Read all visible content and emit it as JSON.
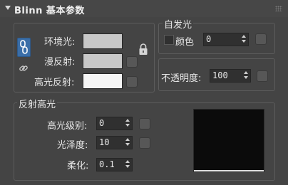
{
  "rollout": {
    "title": "Blinn 基本参数"
  },
  "ambient_group": {
    "ambient_label": "环境光:",
    "diffuse_label": "漫反射:",
    "specular_label": "高光反射:",
    "ambient_color": "#c8c8c8",
    "diffuse_color": "#c8c8c8",
    "specular_color": "#f5f5f5"
  },
  "self_illumination": {
    "title": "自发光",
    "color_label": "颜色",
    "value": "0"
  },
  "opacity": {
    "label": "不透明度:",
    "value": "100"
  },
  "specular_highlights": {
    "title": "反射高光",
    "level_label": "高光级别:",
    "level_value": "0",
    "gloss_label": "光泽度:",
    "gloss_value": "10",
    "soften_label": "柔化:",
    "soften_value": "0.1"
  },
  "icons": {
    "rollout_toggle": "triangle-down-icon",
    "lock": "padlock-icon",
    "link_ambient": "chain-link-icon",
    "link_small": "chain-icon",
    "grip": "grip-dots-icon"
  },
  "colors": {
    "panel_bg": "#444444",
    "accent_blue": "#3a6ea8",
    "curve_bg": "#0b0b0b"
  }
}
